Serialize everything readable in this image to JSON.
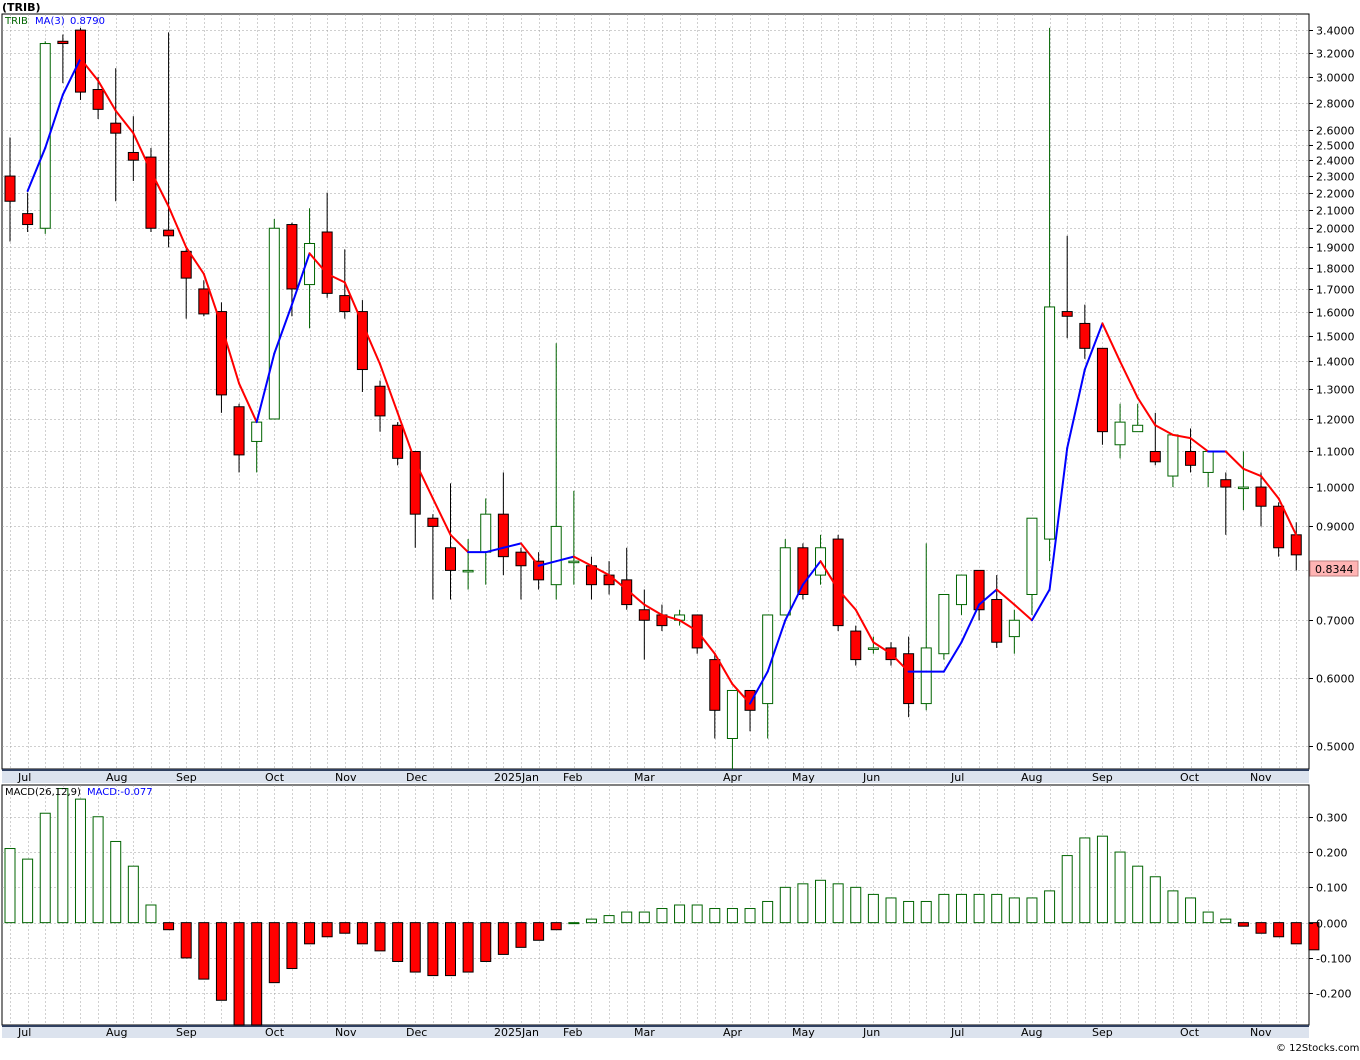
{
  "title": "(TRIB)",
  "price_panel": {
    "legend_symbol": "TRIB",
    "legend_ma_label": "MA(3)",
    "legend_ma_value": "0.8790",
    "last_price_label": "0.8344",
    "y_ticks": [
      "3.4000",
      "3.2000",
      "3.0000",
      "2.8000",
      "2.6000",
      "2.5000",
      "2.4000",
      "2.3000",
      "2.2000",
      "2.1000",
      "2.0000",
      "1.9000",
      "1.8000",
      "1.7000",
      "1.6000",
      "1.5000",
      "1.4000",
      "1.3000",
      "1.2000",
      "1.1000",
      "1.0000",
      "0.9000",
      "0.8000",
      "0.7000",
      "0.6000",
      "0.5000"
    ]
  },
  "macd_panel": {
    "legend_macd_label": "MACD(26,12,9)",
    "legend_macd_value": "MACD:-0.077",
    "y_ticks": [
      "0.300",
      "0.200",
      "0.100",
      "0.000",
      "-0.100",
      "-0.200"
    ]
  },
  "month_labels": [
    "Jul",
    "Aug",
    "Sep",
    "Oct",
    "Nov",
    "Dec",
    "2025Jan",
    "Feb",
    "Mar",
    "Apr",
    "May",
    "Jun",
    "Jul",
    "Aug",
    "Sep",
    "Oct",
    "Nov"
  ],
  "credit": "© 12Stocks.com",
  "colors": {
    "up_candle": "#006400",
    "down_candle": "#ff0000",
    "ma_up": "#0000ff",
    "ma_down": "#ff0000",
    "grid": "#a0a0a0",
    "axis_band": "#2f3f5f",
    "price_box": "#ffb4b4"
  },
  "chart_data": [
    {
      "type": "candlestick",
      "title": "(TRIB)",
      "y_scale": "log",
      "ylim": [
        0.47,
        3.55
      ],
      "grid": true,
      "legend": "top-left",
      "x_months": [
        "Jul",
        "Aug",
        "Sep",
        "Oct",
        "Nov",
        "Dec",
        "2025Jan",
        "Feb",
        "Mar",
        "Apr",
        "May",
        "Jun",
        "Jul",
        "Aug",
        "Sep",
        "Oct",
        "Nov"
      ],
      "candles": [
        {
          "o": 2.3,
          "h": 2.55,
          "l": 1.93,
          "c": 2.15
        },
        {
          "o": 2.08,
          "h": 2.2,
          "l": 1.98,
          "c": 2.02
        },
        {
          "o": 2.0,
          "h": 3.3,
          "l": 1.97,
          "c": 3.28
        },
        {
          "o": 3.3,
          "h": 3.36,
          "l": 2.95,
          "c": 3.28
        },
        {
          "o": 3.4,
          "h": 3.42,
          "l": 2.82,
          "c": 2.88
        },
        {
          "o": 2.9,
          "h": 3.0,
          "l": 2.68,
          "c": 2.75
        },
        {
          "o": 2.65,
          "h": 3.07,
          "l": 2.15,
          "c": 2.58
        },
        {
          "o": 2.45,
          "h": 2.7,
          "l": 2.27,
          "c": 2.4
        },
        {
          "o": 2.42,
          "h": 2.48,
          "l": 1.98,
          "c": 2.0
        },
        {
          "o": 1.99,
          "h": 3.38,
          "l": 1.9,
          "c": 1.96
        },
        {
          "o": 1.88,
          "h": 1.89,
          "l": 1.57,
          "c": 1.75
        },
        {
          "o": 1.7,
          "h": 1.74,
          "l": 1.58,
          "c": 1.59
        },
        {
          "o": 1.6,
          "h": 1.64,
          "l": 1.22,
          "c": 1.28
        },
        {
          "o": 1.24,
          "h": 1.25,
          "l": 1.04,
          "c": 1.09
        },
        {
          "o": 1.13,
          "h": 1.2,
          "l": 1.04,
          "c": 1.19
        },
        {
          "o": 1.2,
          "h": 2.05,
          "l": 1.2,
          "c": 2.0
        },
        {
          "o": 2.02,
          "h": 2.03,
          "l": 1.58,
          "c": 1.7
        },
        {
          "o": 1.72,
          "h": 2.11,
          "l": 1.53,
          "c": 1.92
        },
        {
          "o": 1.98,
          "h": 2.2,
          "l": 1.66,
          "c": 1.68
        },
        {
          "o": 1.67,
          "h": 1.89,
          "l": 1.57,
          "c": 1.6
        },
        {
          "o": 1.6,
          "h": 1.65,
          "l": 1.29,
          "c": 1.37
        },
        {
          "o": 1.31,
          "h": 1.33,
          "l": 1.16,
          "c": 1.21
        },
        {
          "o": 1.18,
          "h": 1.19,
          "l": 1.06,
          "c": 1.08
        },
        {
          "o": 1.1,
          "h": 1.1,
          "l": 0.85,
          "c": 0.93
        },
        {
          "o": 0.92,
          "h": 0.93,
          "l": 0.74,
          "c": 0.9
        },
        {
          "o": 0.85,
          "h": 1.01,
          "l": 0.74,
          "c": 0.8
        },
        {
          "o": 0.8,
          "h": 0.87,
          "l": 0.76,
          "c": 0.8
        },
        {
          "o": 0.84,
          "h": 0.97,
          "l": 0.77,
          "c": 0.93
        },
        {
          "o": 0.93,
          "h": 1.04,
          "l": 0.79,
          "c": 0.83
        },
        {
          "o": 0.84,
          "h": 0.85,
          "l": 0.74,
          "c": 0.81
        },
        {
          "o": 0.82,
          "h": 0.84,
          "l": 0.76,
          "c": 0.78
        },
        {
          "o": 0.77,
          "h": 1.47,
          "l": 0.74,
          "c": 0.9
        },
        {
          "o": 0.82,
          "h": 0.99,
          "l": 0.77,
          "c": 0.82
        },
        {
          "o": 0.81,
          "h": 0.83,
          "l": 0.74,
          "c": 0.77
        },
        {
          "o": 0.79,
          "h": 0.82,
          "l": 0.75,
          "c": 0.77
        },
        {
          "o": 0.78,
          "h": 0.85,
          "l": 0.72,
          "c": 0.73
        },
        {
          "o": 0.72,
          "h": 0.76,
          "l": 0.63,
          "c": 0.7
        },
        {
          "o": 0.71,
          "h": 0.73,
          "l": 0.68,
          "c": 0.69
        },
        {
          "o": 0.7,
          "h": 0.72,
          "l": 0.69,
          "c": 0.71
        },
        {
          "o": 0.71,
          "h": 0.71,
          "l": 0.64,
          "c": 0.65
        },
        {
          "o": 0.63,
          "h": 0.64,
          "l": 0.51,
          "c": 0.55
        },
        {
          "o": 0.51,
          "h": 0.58,
          "l": 0.47,
          "c": 0.58
        },
        {
          "o": 0.58,
          "h": 0.58,
          "l": 0.52,
          "c": 0.55
        },
        {
          "o": 0.56,
          "h": 0.71,
          "l": 0.51,
          "c": 0.71
        },
        {
          "o": 0.71,
          "h": 0.87,
          "l": 0.71,
          "c": 0.85
        },
        {
          "o": 0.85,
          "h": 0.86,
          "l": 0.74,
          "c": 0.75
        },
        {
          "o": 0.79,
          "h": 0.88,
          "l": 0.77,
          "c": 0.85
        },
        {
          "o": 0.87,
          "h": 0.88,
          "l": 0.68,
          "c": 0.69
        },
        {
          "o": 0.68,
          "h": 0.69,
          "l": 0.62,
          "c": 0.63
        },
        {
          "o": 0.65,
          "h": 0.67,
          "l": 0.64,
          "c": 0.65
        },
        {
          "o": 0.65,
          "h": 0.66,
          "l": 0.62,
          "c": 0.63
        },
        {
          "o": 0.64,
          "h": 0.67,
          "l": 0.54,
          "c": 0.56
        },
        {
          "o": 0.56,
          "h": 0.86,
          "l": 0.55,
          "c": 0.65
        },
        {
          "o": 0.64,
          "h": 0.75,
          "l": 0.63,
          "c": 0.75
        },
        {
          "o": 0.73,
          "h": 0.79,
          "l": 0.71,
          "c": 0.79
        },
        {
          "o": 0.8,
          "h": 0.8,
          "l": 0.7,
          "c": 0.72
        },
        {
          "o": 0.74,
          "h": 0.79,
          "l": 0.65,
          "c": 0.66
        },
        {
          "o": 0.67,
          "h": 0.72,
          "l": 0.64,
          "c": 0.7
        },
        {
          "o": 0.75,
          "h": 0.92,
          "l": 0.71,
          "c": 0.92
        },
        {
          "o": 0.87,
          "h": 3.42,
          "l": 0.82,
          "c": 1.62
        },
        {
          "o": 1.6,
          "h": 1.96,
          "l": 1.49,
          "c": 1.58
        },
        {
          "o": 1.55,
          "h": 1.63,
          "l": 1.41,
          "c": 1.45
        },
        {
          "o": 1.45,
          "h": 1.45,
          "l": 1.12,
          "c": 1.16
        },
        {
          "o": 1.12,
          "h": 1.25,
          "l": 1.08,
          "c": 1.19
        },
        {
          "o": 1.16,
          "h": 1.25,
          "l": 1.16,
          "c": 1.18
        },
        {
          "o": 1.1,
          "h": 1.22,
          "l": 1.06,
          "c": 1.07
        },
        {
          "o": 1.03,
          "h": 1.15,
          "l": 1.0,
          "c": 1.15
        },
        {
          "o": 1.1,
          "h": 1.17,
          "l": 1.04,
          "c": 1.06
        },
        {
          "o": 1.04,
          "h": 1.1,
          "l": 1.0,
          "c": 1.1
        },
        {
          "o": 1.02,
          "h": 1.04,
          "l": 0.88,
          "c": 1.0
        },
        {
          "o": 1.0,
          "h": 1.1,
          "l": 0.94,
          "c": 1.0
        },
        {
          "o": 1.0,
          "h": 1.04,
          "l": 0.9,
          "c": 0.95
        },
        {
          "o": 0.95,
          "h": 0.96,
          "l": 0.83,
          "c": 0.85
        },
        {
          "o": 0.88,
          "h": 0.91,
          "l": 0.8,
          "c": 0.834
        }
      ],
      "ma3": [
        null,
        2.21,
        2.48,
        2.86,
        3.15,
        2.97,
        2.74,
        2.58,
        2.33,
        2.12,
        1.9,
        1.77,
        1.54,
        1.32,
        1.19,
        1.43,
        1.63,
        1.87,
        1.77,
        1.73,
        1.55,
        1.39,
        1.22,
        1.07,
        0.97,
        0.88,
        0.84,
        0.84,
        0.85,
        0.86,
        0.81,
        0.82,
        0.83,
        0.81,
        0.79,
        0.76,
        0.73,
        0.71,
        0.7,
        0.68,
        0.64,
        0.59,
        0.56,
        0.61,
        0.7,
        0.77,
        0.82,
        0.76,
        0.72,
        0.66,
        0.64,
        0.61,
        0.61,
        0.61,
        0.66,
        0.73,
        0.76,
        0.73,
        0.7,
        0.76,
        1.11,
        1.37,
        1.55,
        1.4,
        1.27,
        1.18,
        1.15,
        1.14,
        1.1,
        1.1,
        1.05,
        1.03,
        0.97,
        0.879
      ]
    },
    {
      "type": "bar",
      "title": "MACD(26,12,9)",
      "ylim": [
        -0.29,
        0.39
      ],
      "grid": true,
      "legend": "top-left",
      "values": [
        0.21,
        0.18,
        0.31,
        0.38,
        0.35,
        0.3,
        0.23,
        0.16,
        0.05,
        -0.02,
        -0.1,
        -0.16,
        -0.22,
        -0.29,
        -0.29,
        -0.17,
        -0.13,
        -0.06,
        -0.04,
        -0.03,
        -0.06,
        -0.08,
        -0.11,
        -0.14,
        -0.15,
        -0.15,
        -0.14,
        -0.11,
        -0.09,
        -0.07,
        -0.05,
        -0.02,
        0.0,
        0.01,
        0.02,
        0.03,
        0.03,
        0.04,
        0.05,
        0.05,
        0.04,
        0.04,
        0.04,
        0.06,
        0.1,
        0.11,
        0.12,
        0.11,
        0.1,
        0.08,
        0.07,
        0.06,
        0.06,
        0.08,
        0.08,
        0.08,
        0.08,
        0.07,
        0.07,
        0.09,
        0.19,
        0.24,
        0.245,
        0.2,
        0.16,
        0.13,
        0.09,
        0.07,
        0.03,
        0.01,
        -0.01,
        -0.03,
        -0.04,
        -0.06,
        -0.077
      ]
    }
  ]
}
